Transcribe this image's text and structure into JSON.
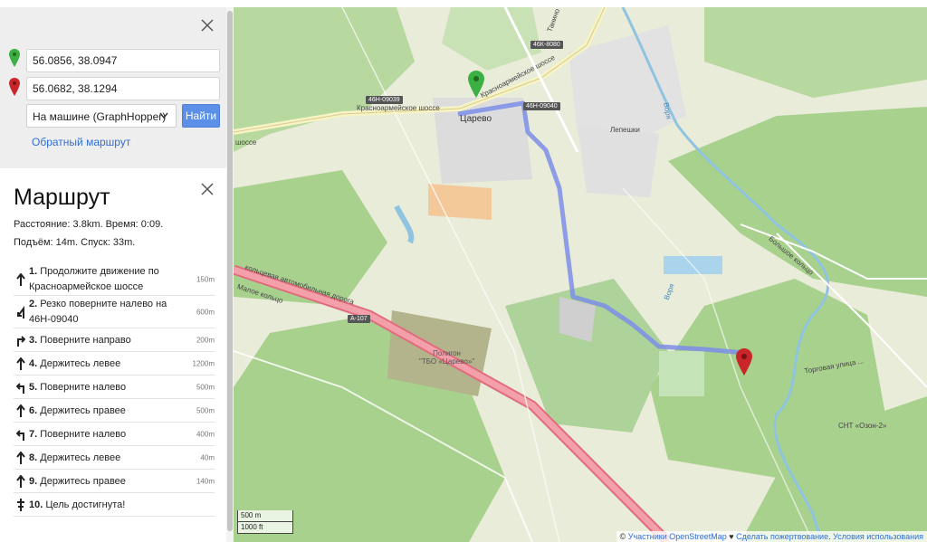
{
  "search": {
    "from_value": "56.0856, 38.0947",
    "to_value": "56.0682, 38.1294",
    "mode_label": "На машине (GraphHopper)",
    "find_label": "Найти",
    "reverse_label": "Обратный маршрут"
  },
  "route": {
    "title": "Маршрут",
    "summary_line1": "Расстояние: 3.8km. Время: 0:09.",
    "summary_line2": "Подъём: 14m. Спуск: 33m.",
    "steps": [
      {
        "num": "1.",
        "text": "Продолжите движение по Красноармейское шоссе",
        "dist": "150m",
        "icon": "arrow-up-icon"
      },
      {
        "num": "2.",
        "text": "Резко поверните налево на 46Н-09040",
        "dist": "600m",
        "icon": "sharp-left-icon"
      },
      {
        "num": "3.",
        "text": "Поверните направо",
        "dist": "200m",
        "icon": "turn-right-icon"
      },
      {
        "num": "4.",
        "text": "Держитесь левее",
        "dist": "1200m",
        "icon": "keep-left-icon"
      },
      {
        "num": "5.",
        "text": "Поверните налево",
        "dist": "500m",
        "icon": "turn-left-icon"
      },
      {
        "num": "6.",
        "text": "Держитесь правее",
        "dist": "500m",
        "icon": "keep-right-icon"
      },
      {
        "num": "7.",
        "text": "Поверните налево",
        "dist": "400m",
        "icon": "turn-left-icon"
      },
      {
        "num": "8.",
        "text": "Держитесь левее",
        "dist": "40m",
        "icon": "keep-left-icon"
      },
      {
        "num": "9.",
        "text": "Держитесь правее",
        "dist": "140m",
        "icon": "keep-right-icon"
      },
      {
        "num": "10.",
        "text": "Цель достигнута!",
        "dist": "",
        "icon": "destination-icon"
      }
    ]
  },
  "map": {
    "labels": {
      "tsarevo": "Царево",
      "lepeshki": "Лепешки",
      "krasnoarm": "Красноармейское шоссе",
      "krasnoarm2": "Красноармейское шоссе",
      "shosse": "шоссе",
      "poligon": "Полигон\n\"ТБО «Царево»\"",
      "snt": "СНТ «Озон-2»",
      "vorya": "Воря",
      "vorya2": "Воря",
      "ring": "Малое кольцо",
      "ring2": "кольцевая автомобильная дорога",
      "bolshoe": "Большое кольцо",
      "tanino": "Танино",
      "ozon": "Торговая улица ..."
    },
    "shields": {
      "s1": "46К-8080",
      "s2": "46Н-09039",
      "s3": "46Н-09040",
      "s4": "А-107"
    },
    "scale_m": "500 m",
    "scale_ft": "1000 ft",
    "attribution_prefix": "© ",
    "attribution_osm": "Участники OpenStreetMap",
    "attribution_heart": " ♥ ",
    "attribution_donate": "Сделать пожертвование",
    "attribution_sep": ". ",
    "attribution_terms": "Условия использования",
    "colors": {
      "route": "#7d8ee8",
      "start_marker": "#3cb043",
      "end_marker": "#c9262b",
      "highway": "#f39a9a",
      "forest": "#a8d191",
      "water": "#a8d4e6"
    }
  }
}
